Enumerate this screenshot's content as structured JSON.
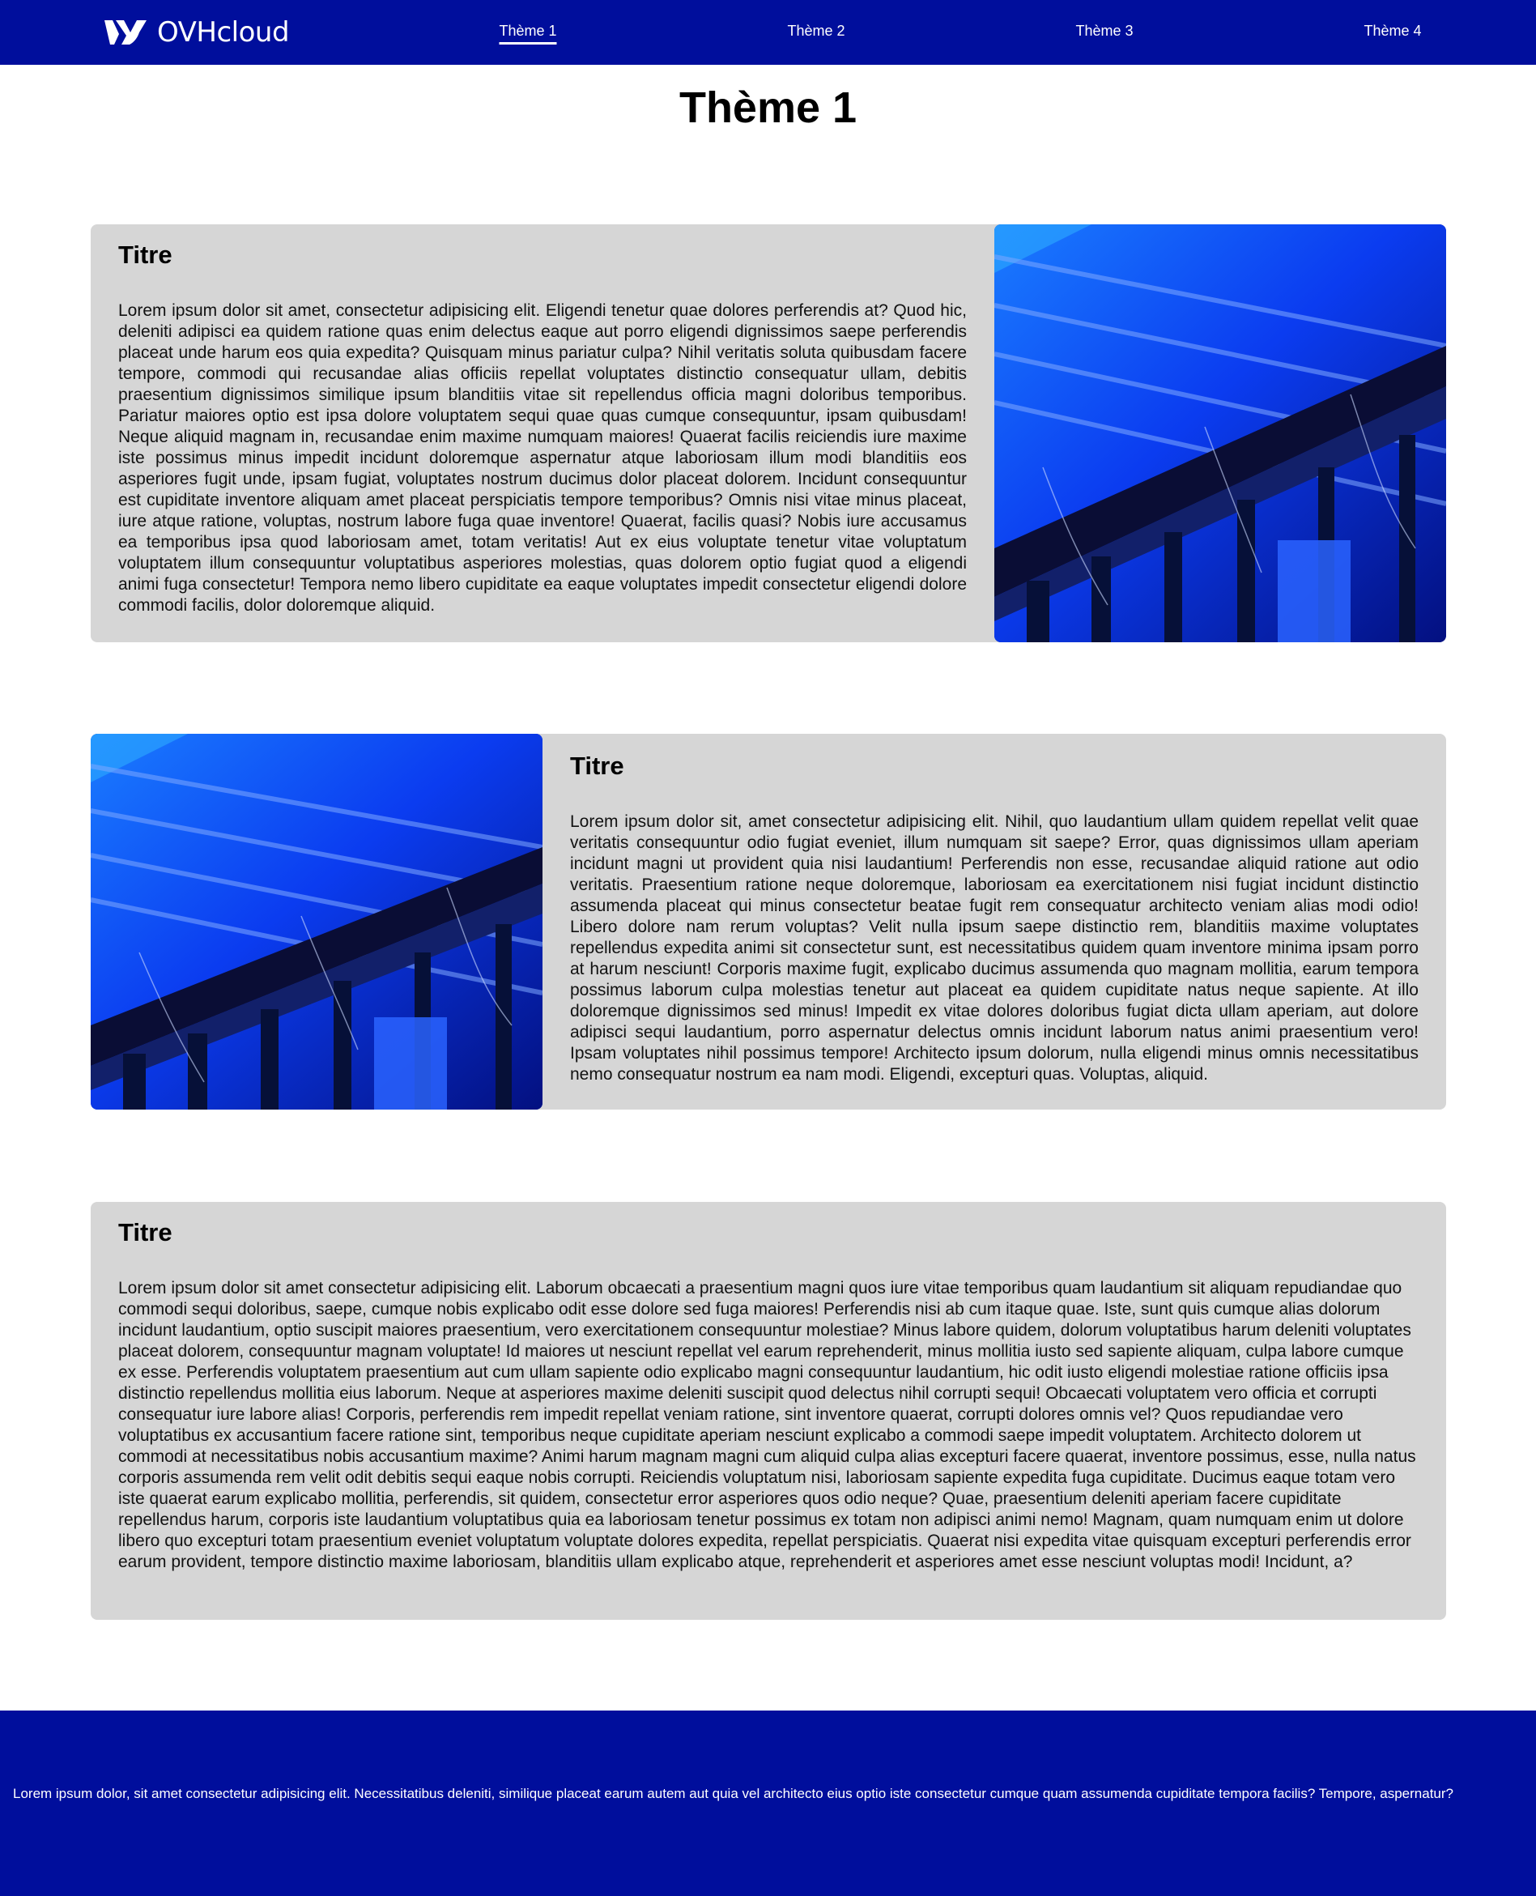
{
  "brand": {
    "name": "OVHcloud",
    "colors": {
      "primary": "#000e9c",
      "card_background": "#d6d6d6",
      "text": "#111111"
    }
  },
  "nav": {
    "items": [
      {
        "label": "Thème 1",
        "active": true
      },
      {
        "label": "Thème 2",
        "active": false
      },
      {
        "label": "Thème 3",
        "active": false
      },
      {
        "label": "Thème 4",
        "active": false
      }
    ]
  },
  "page": {
    "title": "Thème 1"
  },
  "cards": [
    {
      "title": "Titre",
      "image_position": "right",
      "image_icon": "datacenter-photo",
      "body": "Lorem ipsum dolor sit amet, consectetur adipisicing elit. Eligendi tenetur quae dolores perferendis at? Quod hic, deleniti adipisci ea quidem ratione quas enim delectus eaque aut porro eligendi dignissimos saepe perferendis placeat unde harum eos quia expedita? Quisquam minus pariatur culpa? Nihil veritatis soluta quibusdam facere tempore, commodi qui recusandae alias officiis repellat voluptates distinctio consequatur ullam, debitis praesentium dignissimos similique ipsum blanditiis vitae sit repellendus officia magni doloribus temporibus. Pariatur maiores optio est ipsa dolore voluptatem sequi quae quas cumque consequuntur, ipsam quibusdam! Neque aliquid magnam in, recusandae enim maxime numquam maiores! Quaerat facilis reiciendis iure maxime iste possimus minus impedit incidunt doloremque aspernatur atque laboriosam illum modi blanditiis eos asperiores fugit unde, ipsam fugiat, voluptates nostrum ducimus dolor placeat dolorem. Incidunt consequuntur est cupiditate inventore aliquam amet placeat perspiciatis tempore temporibus? Omnis nisi vitae minus placeat, iure atque ratione, voluptas, nostrum labore fuga quae inventore! Quaerat, facilis quasi? Nobis iure accusamus ea temporibus ipsa quod laboriosam amet, totam veritatis! Aut ex eius voluptate tenetur vitae voluptatum voluptatem illum consequuntur voluptatibus asperiores molestias, quas dolorem optio fugiat quod a eligendi animi fuga consectetur! Tempora nemo libero cupiditate ea eaque voluptates impedit consectetur eligendi dolore commodi facilis, dolor doloremque aliquid."
    },
    {
      "title": "Titre",
      "image_position": "left",
      "image_icon": "datacenter-photo",
      "body": "Lorem ipsum dolor sit, amet consectetur adipisicing elit. Nihil, quo laudantium ullam quidem repellat velit quae veritatis consequuntur odio fugiat eveniet, illum numquam sit saepe? Error, quas dignissimos ullam aperiam incidunt magni ut provident quia nisi laudantium! Perferendis non esse, recusandae aliquid ratione aut odio veritatis. Praesentium ratione neque doloremque, laboriosam ea exercitationem nisi fugiat incidunt distinctio assumenda placeat qui minus consectetur beatae fugit rem consequatur architecto veniam alias modi odio! Libero dolore nam rerum voluptas? Velit nulla ipsum saepe distinctio rem, blanditiis maxime voluptates repellendus expedita animi sit consectetur sunt, est necessitatibus quidem quam inventore minima ipsam porro at harum nesciunt! Corporis maxime fugit, explicabo ducimus assumenda quo magnam mollitia, earum tempora possimus laborum culpa molestias tenetur aut placeat ea quidem cupiditate natus neque sapiente. At illo doloremque dignissimos sed minus! Impedit ex vitae dolores doloribus fugiat dicta ullam aperiam, aut dolore adipisci sequi laudantium, porro aspernatur delectus omnis incidunt laborum natus animi praesentium vero! Ipsam voluptates nihil possimus tempore! Architecto ipsum dolorum, nulla eligendi minus omnis necessitatibus nemo consequatur nostrum ea nam modi. Eligendi, excepturi quas. Voluptas, aliquid."
    },
    {
      "title": "Titre",
      "image_position": "none",
      "body": "Lorem ipsum dolor sit amet consectetur adipisicing elit. Laborum obcaecati a praesentium magni quos iure vitae temporibus quam laudantium sit aliquam repudiandae quo commodi sequi doloribus, saepe, cumque nobis explicabo odit esse dolore sed fuga maiores! Perferendis nisi ab cum itaque quae. Iste, sunt quis cumque alias dolorum incidunt laudantium, optio suscipit maiores praesentium, vero exercitationem consequuntur molestiae? Minus labore quidem, dolorum voluptatibus harum deleniti voluptates placeat dolorem, consequuntur magnam voluptate! Id maiores ut nesciunt repellat vel earum reprehenderit, minus mollitia iusto sed sapiente aliquam, culpa labore cumque ex esse. Perferendis voluptatem praesentium aut cum ullam sapiente odio explicabo magni consequuntur laudantium, hic odit iusto eligendi molestiae ratione officiis ipsa distinctio repellendus mollitia eius laborum. Neque at asperiores maxime deleniti suscipit quod delectus nihil corrupti sequi! Obcaecati voluptatem vero officia et corrupti consequatur iure labore alias! Corporis, perferendis rem impedit repellat veniam ratione, sint inventore quaerat, corrupti dolores omnis vel? Quos repudiandae vero voluptatibus ex accusantium facere ratione sint, temporibus neque cupiditate aperiam nesciunt explicabo a commodi saepe impedit voluptatem. Architecto dolorem ut commodi at necessitatibus nobis accusantium maxime? Animi harum magnam magni cum aliquid culpa alias excepturi facere quaerat, inventore possimus, esse, nulla natus corporis assumenda rem velit odit debitis sequi eaque nobis corrupti. Reiciendis voluptatum nisi, laboriosam sapiente expedita fuga cupiditate. Ducimus eaque totam vero iste quaerat earum explicabo mollitia, perferendis, sit quidem, consectetur error asperiores quos odio neque? Quae, praesentium deleniti aperiam facere cupiditate repellendus harum, corporis iste laudantium voluptatibus quia ea laboriosam tenetur possimus ex totam non adipisci animi nemo! Magnam, quam numquam enim ut dolore libero quo excepturi totam praesentium eveniet voluptatum voluptate dolores expedita, repellat perspiciatis. Quaerat nisi expedita vitae quisquam excepturi perferendis error earum provident, tempore distinctio maxime laboriosam, blanditiis ullam explicabo atque, reprehenderit et asperiores amet esse nesciunt voluptas modi! Incidunt, a?"
    }
  ],
  "footer": {
    "text": "Lorem ipsum dolor, sit amet consectetur adipisicing elit. Necessitatibus deleniti, similique placeat earum autem aut quia vel architecto eius optio iste consectetur cumque quam assumenda cupiditate tempora facilis? Tempore, aspernatur?"
  }
}
